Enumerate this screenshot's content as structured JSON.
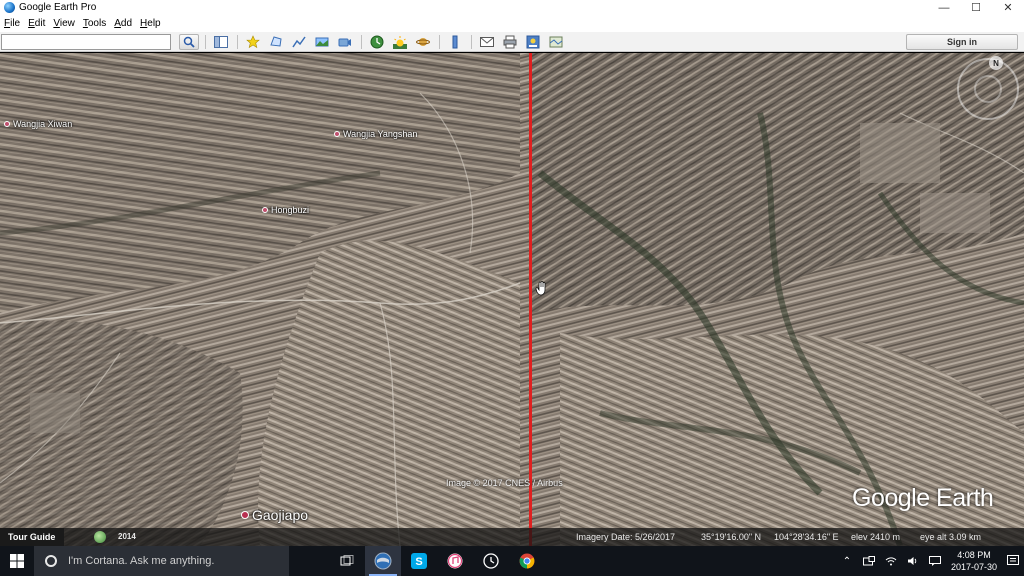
{
  "window": {
    "title": "Google Earth Pro",
    "minimize": "—",
    "maximize": "☐",
    "close": "✕"
  },
  "menu": [
    {
      "label": "File",
      "u": "F",
      "rest": "ile"
    },
    {
      "label": "Edit",
      "u": "E",
      "rest": "dit"
    },
    {
      "label": "View",
      "u": "V",
      "rest": "iew"
    },
    {
      "label": "Tools",
      "u": "T",
      "rest": "ools"
    },
    {
      "label": "Add",
      "u": "A",
      "rest": "dd"
    },
    {
      "label": "Help",
      "u": "H",
      "rest": "elp"
    }
  ],
  "toolbar": {
    "search_value": "",
    "sign_in_label": "Sign in",
    "icons": [
      "search-icon",
      "sidebar-toggle-icon",
      "placemark-icon",
      "polygon-icon",
      "path-icon",
      "image-overlay-icon",
      "record-tour-icon",
      "historical-imagery-icon",
      "sunlight-icon",
      "planets-icon",
      "ruler-icon",
      "email-icon",
      "print-icon",
      "save-image-icon",
      "view-in-maps-icon"
    ]
  },
  "map": {
    "places": [
      {
        "name": "Wangjia Xiwan"
      },
      {
        "name": "Wangjia Yangshan"
      },
      {
        "name": "Hongbuzi"
      },
      {
        "name": "Gaojiapo"
      }
    ],
    "copyright": "Image © 2017 CNES / Airbus",
    "logo": "Google Earth",
    "compass_letter": "N",
    "colors": {
      "swipe_line": "#e02020"
    }
  },
  "statusbar": {
    "tour_guide": "Tour Guide",
    "history_year": "2014",
    "imagery_date": "Imagery Date: 5/26/2017",
    "latitude": "35°19'16.00\" N",
    "longitude": "104°28'34.16\" E",
    "elevation": "elev 2410 m",
    "eye_alt": "eye alt   3.09 km"
  },
  "taskbar": {
    "cortana_placeholder": "I'm Cortana. Ask me anything.",
    "apps": [
      "task-view-icon",
      "google-earth-icon",
      "skype-icon",
      "itunes-icon",
      "clock-app-icon",
      "chrome-icon"
    ],
    "time": "4:08 PM",
    "date": "2017-07-30"
  }
}
